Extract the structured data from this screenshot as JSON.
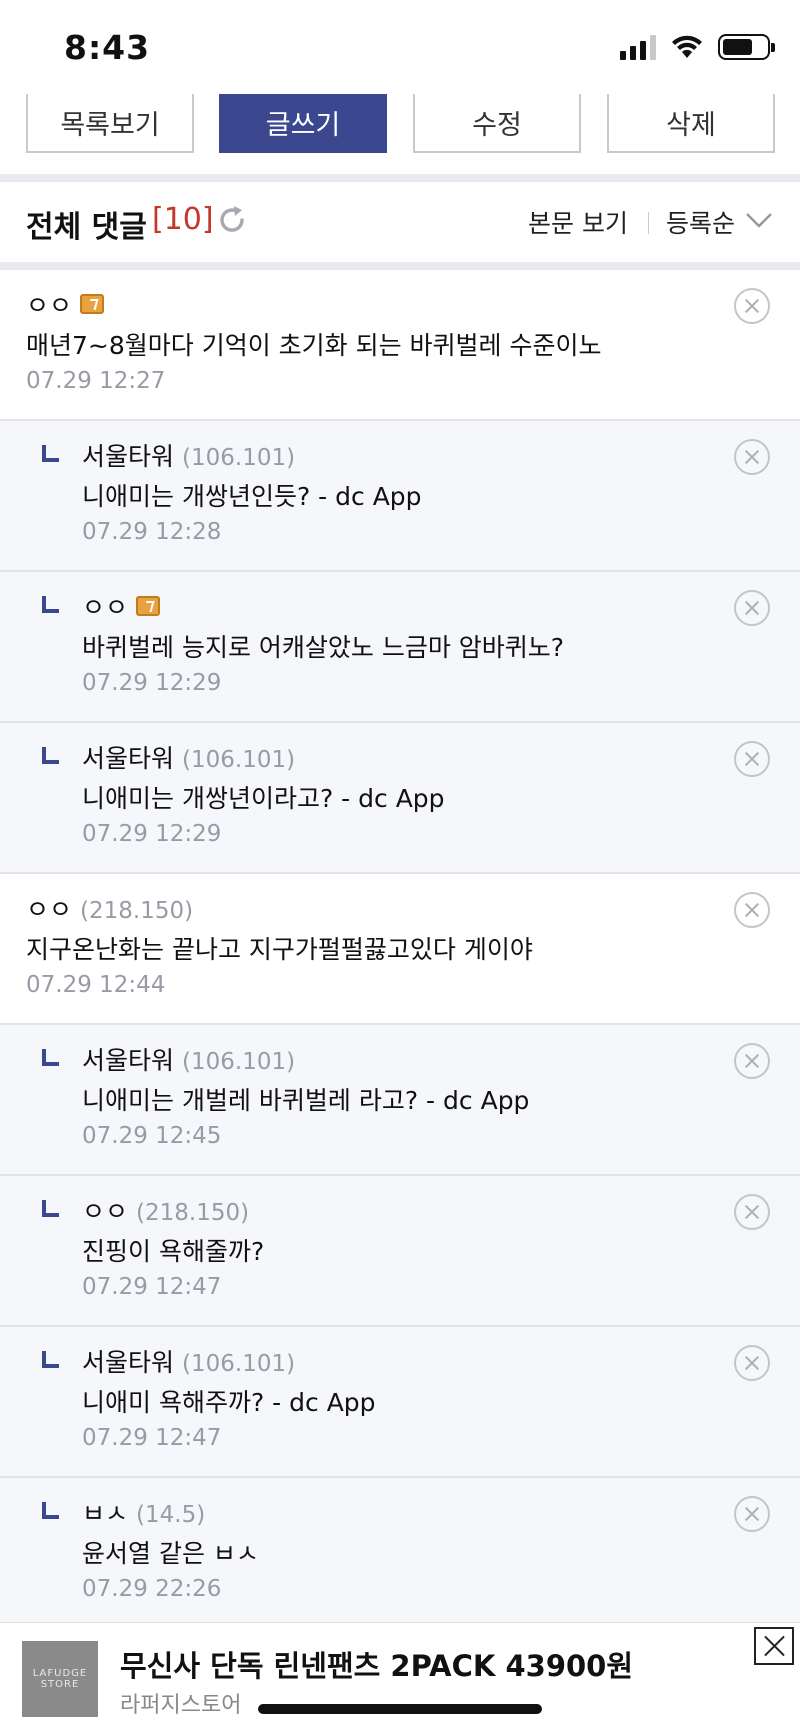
{
  "status_bar": {
    "time": "8:43"
  },
  "actions": {
    "list_label": "목록보기",
    "write_label": "글쓰기",
    "edit_label": "수정",
    "delete_label": "삭제"
  },
  "comments_header": {
    "title": "전체 댓글",
    "count": "[10]",
    "view_body_label": "본문 보기",
    "sort_label": "등록순"
  },
  "comments": [
    {
      "author": "ㅇㅇ",
      "ip": "",
      "fixed": true,
      "reply": false,
      "text": "매년7~8월마다 기억이 초기화 되는 바퀴벌레 수준이노",
      "date": "07.29 12:27"
    },
    {
      "author": "서울타워",
      "ip": "(106.101)",
      "fixed": false,
      "reply": true,
      "text": "니애미는 개쌍년인듯? - dc App",
      "date": "07.29 12:28"
    },
    {
      "author": "ㅇㅇ",
      "ip": "",
      "fixed": true,
      "reply": true,
      "text": "바퀴벌레 능지로 어캐살았노 느금마 암바퀴노?",
      "date": "07.29 12:29"
    },
    {
      "author": "서울타워",
      "ip": "(106.101)",
      "fixed": false,
      "reply": true,
      "text": "니애미는 개쌍년이라고? - dc App",
      "date": "07.29 12:29"
    },
    {
      "author": "ㅇㅇ",
      "ip": "(218.150)",
      "fixed": false,
      "reply": false,
      "text": "지구온난화는 끝나고 지구가펄펄끓고있다 게이야",
      "date": "07.29 12:44"
    },
    {
      "author": "서울타워",
      "ip": "(106.101)",
      "fixed": false,
      "reply": true,
      "text": "니애미는 개벌레 바퀴벌레 라고? - dc App",
      "date": "07.29 12:45"
    },
    {
      "author": "ㅇㅇ",
      "ip": "(218.150)",
      "fixed": false,
      "reply": true,
      "text": "진핑이 욕해줄까?",
      "date": "07.29 12:47"
    },
    {
      "author": "서울타워",
      "ip": "(106.101)",
      "fixed": false,
      "reply": true,
      "text": "니애미 욕해주까? - dc App",
      "date": "07.29 12:47"
    },
    {
      "author": "ㅂㅅ",
      "ip": "(14.5)",
      "fixed": false,
      "reply": true,
      "text": "윤서열 같은 ㅂㅅ",
      "date": "07.29 22:26"
    }
  ],
  "ad": {
    "thumb_label": "LAFUDGE STORE",
    "title": "무신사 단독 린넨팬츠 2PACK 43900원",
    "subtitle": "라퍼지스토어"
  },
  "colors": {
    "accent": "#3b4890",
    "count_red": "#c0392b",
    "reply_bg": "#f6f7fb",
    "badge": "#e8a340"
  },
  "icons": [
    "signal-icon",
    "wifi-icon",
    "battery-icon",
    "refresh-icon",
    "chevron-down-icon",
    "reply-arrow-icon",
    "close-circle-icon",
    "fixed-user-icon",
    "close-icon"
  ]
}
